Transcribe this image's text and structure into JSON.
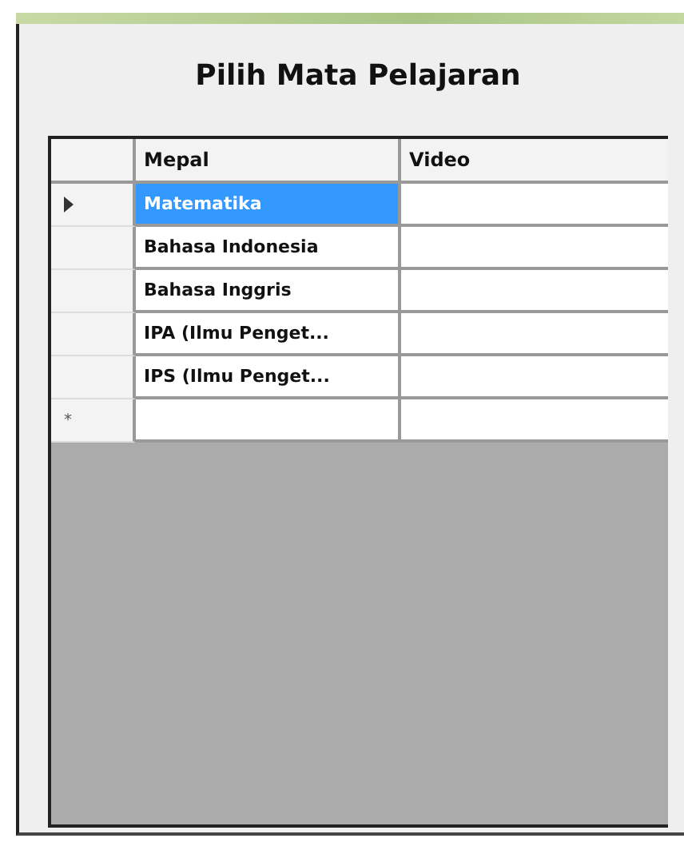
{
  "title": "Pilih Mata Pelajaran",
  "table": {
    "columns": [
      "Mepal",
      "Video"
    ],
    "rows": [
      {
        "cells": [
          "Matematika",
          ""
        ],
        "selected": true,
        "current": true
      },
      {
        "cells": [
          "Bahasa Indonesia",
          ""
        ],
        "selected": false,
        "current": false
      },
      {
        "cells": [
          "Bahasa Inggris",
          ""
        ],
        "selected": false,
        "current": false
      },
      {
        "cells": [
          "IPA (Ilmu Penget...",
          ""
        ],
        "selected": false,
        "current": false
      },
      {
        "cells": [
          "IPS (Ilmu Penget...",
          ""
        ],
        "selected": false,
        "current": false
      }
    ],
    "new_row_marker": "*"
  }
}
